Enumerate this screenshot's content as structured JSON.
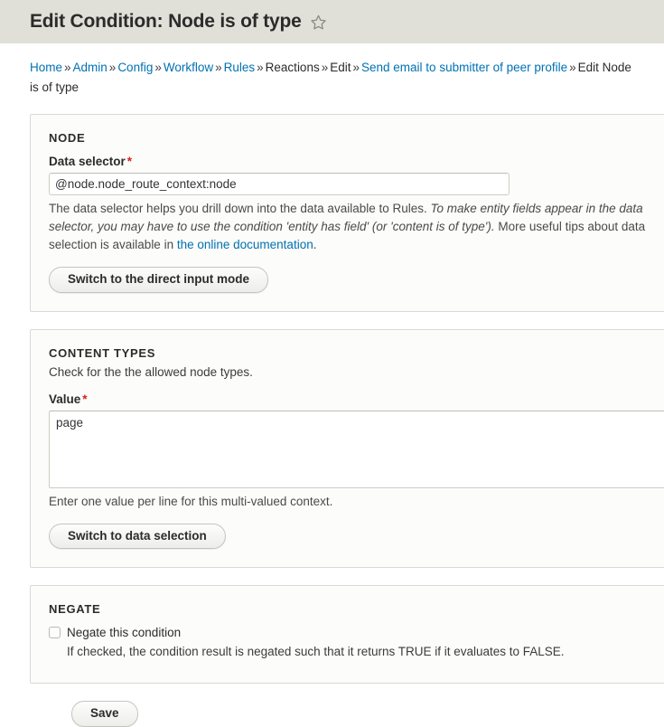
{
  "header": {
    "title": "Edit Condition: Node is of type",
    "star_icon": "star-outline-icon"
  },
  "breadcrumb": {
    "separator": "»",
    "items": [
      {
        "label": "Home",
        "link": true
      },
      {
        "label": "Admin",
        "link": true
      },
      {
        "label": "Config",
        "link": true
      },
      {
        "label": "Workflow",
        "link": true
      },
      {
        "label": "Rules",
        "link": true
      },
      {
        "label": "Reactions",
        "link": false
      },
      {
        "label": "Edit",
        "link": false
      },
      {
        "label": "Send email to submitter of peer profile",
        "link": true
      },
      {
        "label": "Edit Node is of type",
        "link": false
      }
    ]
  },
  "node_section": {
    "legend": "NODE",
    "data_selector": {
      "label": "Data selector",
      "required_marker": "*",
      "value": "@node.node_route_context:node",
      "placeholder": ""
    },
    "help": {
      "part1": "The data selector helps you drill down into the data available to Rules. ",
      "italic": "To make entity fields appear in the data selector, you may have to use the condition 'entity has field' (or 'content is of type').",
      "part2": " More useful tips about data selection is available in ",
      "link_text": "the online documentation",
      "part3": "."
    },
    "switch_button": "Switch to the direct input mode"
  },
  "content_types_section": {
    "legend": "CONTENT TYPES",
    "description": "Check for the the allowed node types.",
    "value_field": {
      "label": "Value",
      "required_marker": "*",
      "value": "page",
      "placeholder": ""
    },
    "help": "Enter one value per line for this multi-valued context.",
    "switch_button": "Switch to data selection"
  },
  "negate_section": {
    "legend": "NEGATE",
    "checkbox_label": "Negate this condition",
    "checkbox_checked": false,
    "description": "If checked, the condition result is negated such that it returns TRUE if it evaluates to FALSE."
  },
  "actions": {
    "save_label": "Save"
  },
  "colors": {
    "titlebar_bg": "#e0e0d8",
    "link": "#0071b3",
    "required": "#d82020",
    "panel_bg": "#fcfcfa",
    "panel_border": "#d9d9d4"
  }
}
